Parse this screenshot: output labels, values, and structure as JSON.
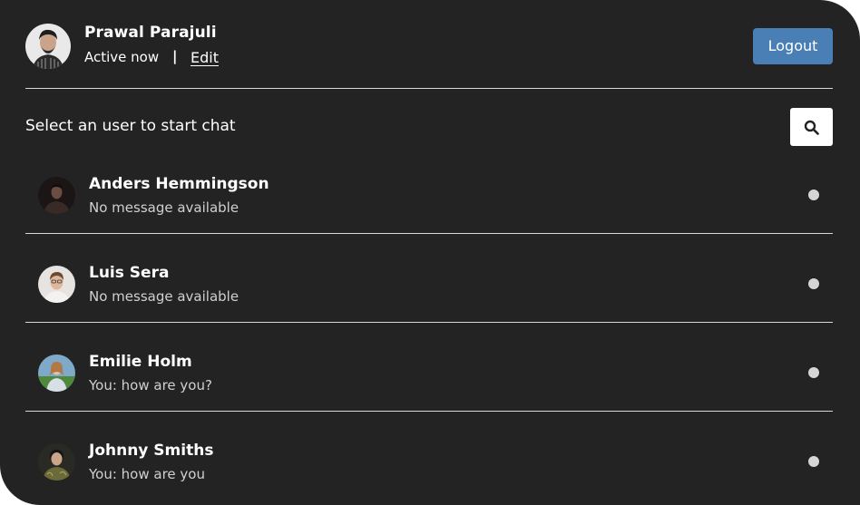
{
  "current_user": {
    "name": "Prawal Parajuli",
    "status": "Active now",
    "separator": "|",
    "edit_label": "Edit",
    "avatar_icon": "user-avatar-portrait"
  },
  "header": {
    "logout_label": "Logout",
    "logout_color": "#4a7fb5"
  },
  "search": {
    "label": "Select an user to start chat",
    "button_icon": "search-icon"
  },
  "users": [
    {
      "name": "Anders Hemmingson",
      "message": "No message available",
      "status": "offline"
    },
    {
      "name": "Luis Sera",
      "message": "No message available",
      "status": "offline"
    },
    {
      "name": "Emilie Holm",
      "message": "You: how are you?",
      "status": "offline"
    },
    {
      "name": "Johnny Smiths",
      "message": "You: how are you",
      "status": "offline"
    }
  ],
  "colors": {
    "background": "#232323",
    "status_dot": "#d6d6d6"
  }
}
